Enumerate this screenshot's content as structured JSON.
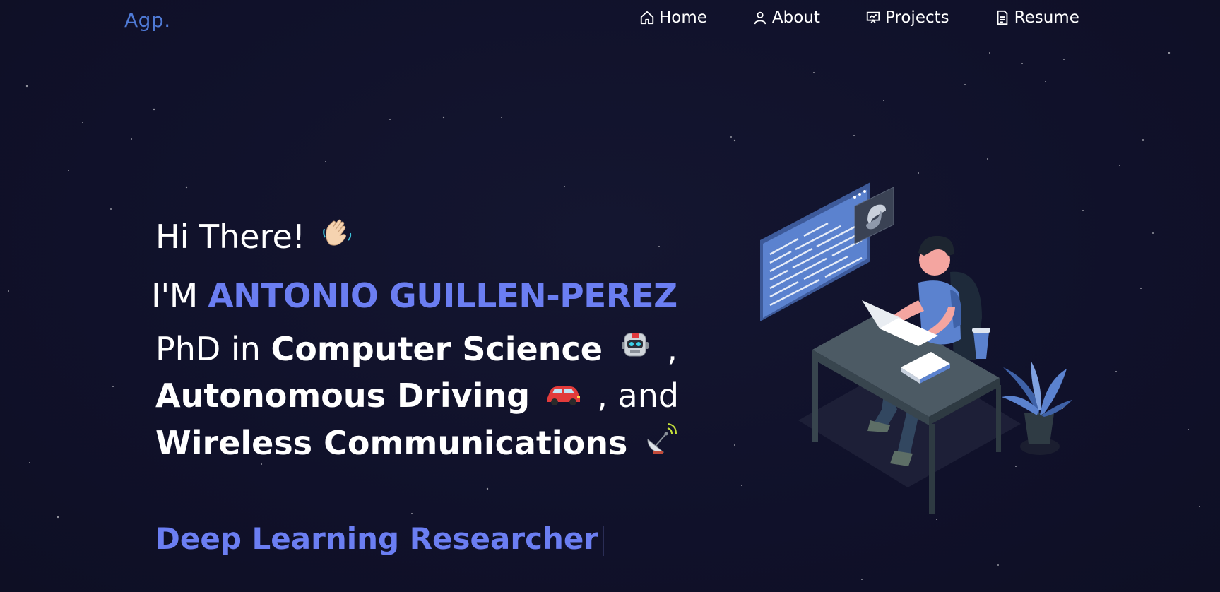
{
  "nav": {
    "brand": "Agp.",
    "links": [
      {
        "label": "Home",
        "icon": "home-icon"
      },
      {
        "label": "About",
        "icon": "user-icon"
      },
      {
        "label": "Projects",
        "icon": "presentation-icon"
      },
      {
        "label": "Resume",
        "icon": "document-icon"
      }
    ]
  },
  "hero": {
    "greeting": "Hi There!",
    "name_prefix": "I'M",
    "name": "ANTONIO GUILLEN-PEREZ",
    "line1_prefix": "PhD in",
    "line1_bold": "Computer Science",
    "line1_suffix": ",",
    "line2_bold": "Autonomous Driving",
    "line2_suffix": ", and",
    "line3_bold": "Wireless Communications",
    "role": "Deep Learning Researcher"
  },
  "icons": {
    "greeting": "waving-hand-icon",
    "cs": "robot-icon",
    "ad": "car-icon",
    "wc": "satellite-dish-icon"
  },
  "colors": {
    "background": "#11122a",
    "accent": "#6b7ef2",
    "brand": "#4f7ad6"
  }
}
